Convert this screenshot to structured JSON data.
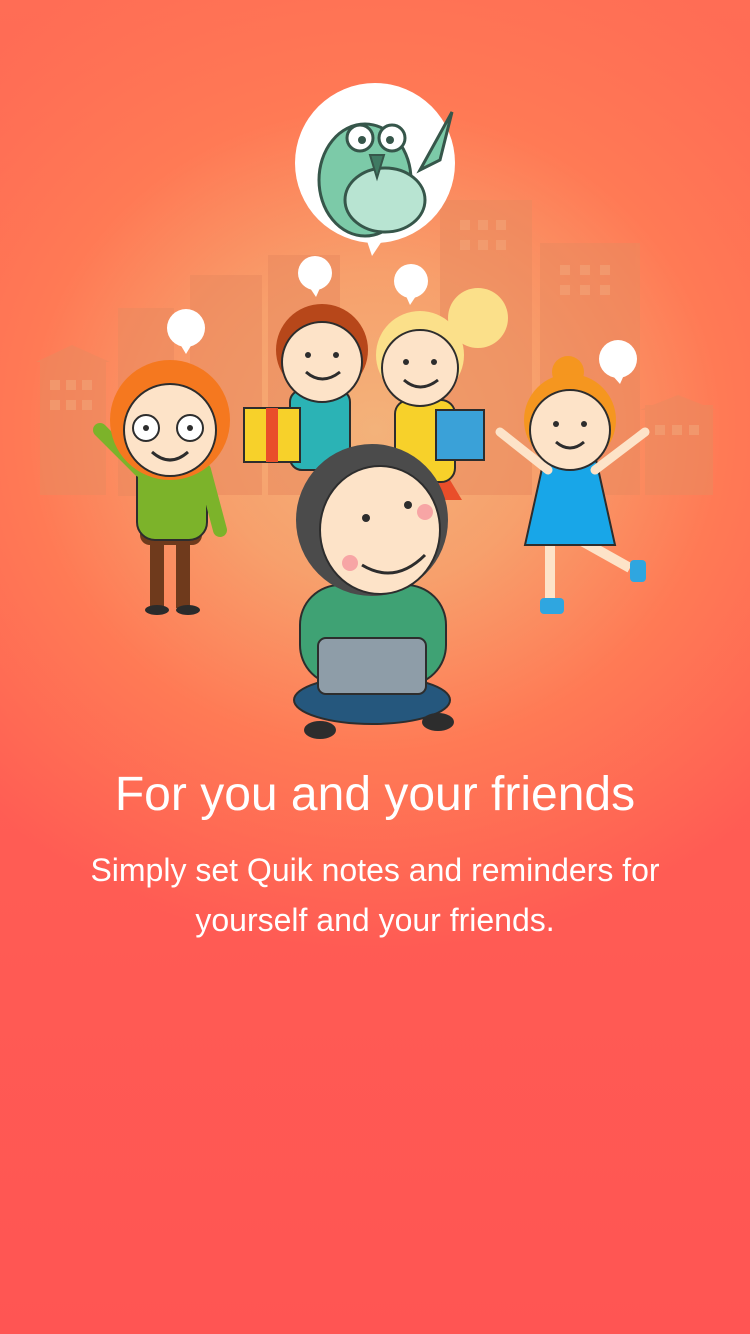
{
  "onboarding": {
    "title": "For you and your friends",
    "description": "Simply set Quik notes and reminders for yourself and your friends."
  },
  "illustration": {
    "mascot": "owl-mascot-icon",
    "colors": {
      "background_top": "#ff6d55",
      "background_bottom": "#ff5553",
      "glow": "#f3b27a",
      "buildings": "#ee8a5e",
      "bubble": "#ffffff",
      "owl": "#7ccaa8"
    }
  }
}
